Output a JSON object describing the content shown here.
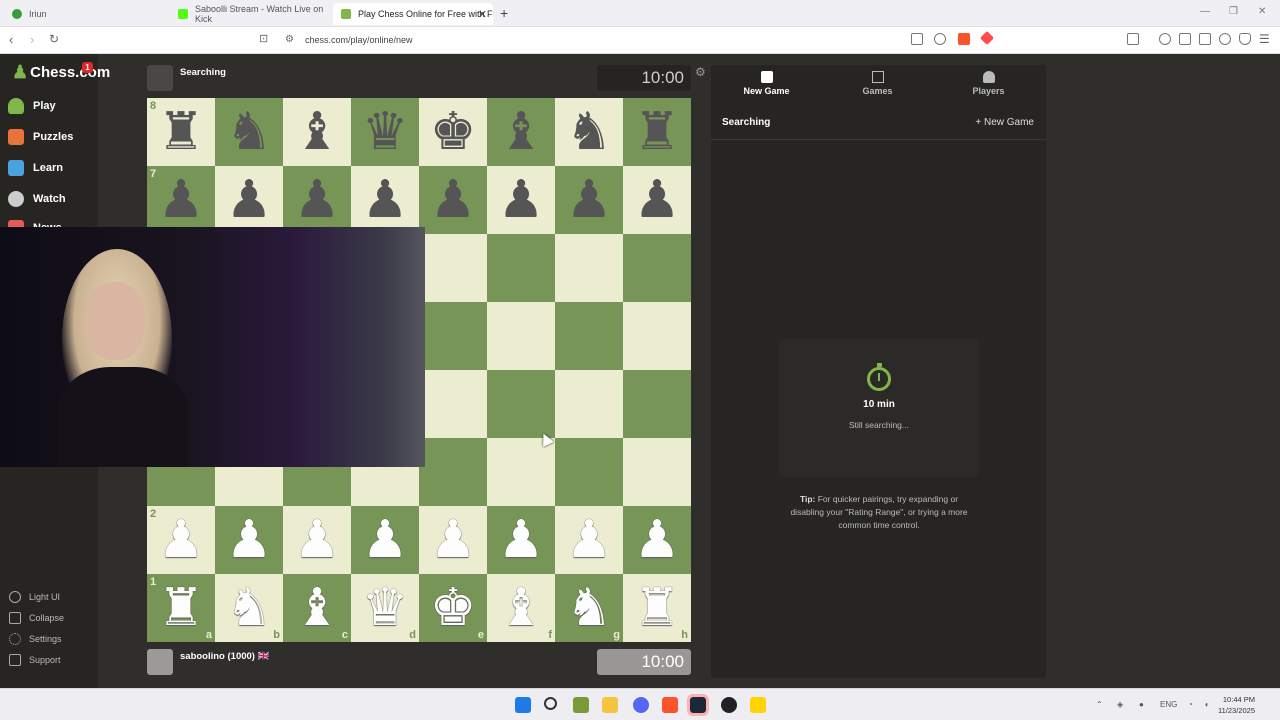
{
  "browser": {
    "tabs": [
      {
        "title": "Iriun",
        "active": false,
        "color": "#3a9b3a"
      },
      {
        "title": "Saboolli Stream - Watch Live on Kick",
        "active": false,
        "color": "#53fc18"
      },
      {
        "title": "Play Chess Online for Free with F",
        "active": true,
        "color": "#81b64c"
      }
    ],
    "url": "chess.com/play/online/new"
  },
  "sidebar": {
    "logo_text": "Chess.com",
    "logo_badge": "1",
    "items": [
      {
        "label": "Play",
        "icon": "play-pawn-icon",
        "color": "#81b64c"
      },
      {
        "label": "Puzzles",
        "icon": "puzzle-icon",
        "color": "#e8743b"
      },
      {
        "label": "Learn",
        "icon": "learn-icon",
        "color": "#4aa3df"
      },
      {
        "label": "Watch",
        "icon": "binoculars-icon",
        "color": "#cccccc"
      },
      {
        "label": "News",
        "icon": "news-icon",
        "color": "#e25a5a"
      }
    ],
    "bottom_items": [
      {
        "label": "Light UI",
        "icon": "contrast-icon"
      },
      {
        "label": "Collapse",
        "icon": "collapse-icon"
      },
      {
        "label": "Settings",
        "icon": "gear-icon"
      },
      {
        "label": "Support",
        "icon": "help-icon"
      }
    ]
  },
  "game": {
    "opponent_label": "Searching",
    "opponent_clock": "10:00",
    "player_label": "saboolino (1000) 🇬🇧",
    "player_clock": "10:00",
    "board": [
      [
        "♜",
        "♞",
        "♝",
        "♛",
        "♚",
        "♝",
        "♞",
        "♜"
      ],
      [
        "♟",
        "♟",
        "♟",
        "♟",
        "♟",
        "♟",
        "♟",
        "♟"
      ],
      [
        "",
        "",
        "",
        "",
        "",
        "",
        "",
        ""
      ],
      [
        "",
        "",
        "",
        "",
        "",
        "",
        "",
        ""
      ],
      [
        "",
        "",
        "",
        "",
        "",
        "",
        "",
        ""
      ],
      [
        "",
        "",
        "",
        "",
        "",
        "",
        "",
        ""
      ],
      [
        "♟",
        "♟",
        "♟",
        "♟",
        "♟",
        "♟",
        "♟",
        "♟"
      ],
      [
        "♜",
        "♞",
        "♝",
        "♛",
        "♚",
        "♝",
        "♞",
        "♜"
      ]
    ],
    "piece_colors": [
      "b",
      "b",
      "",
      "",
      "",
      "",
      "w",
      "w"
    ],
    "rank_labels": [
      "8",
      "7",
      "",
      "",
      "",
      "",
      "2",
      "1"
    ],
    "file_labels": [
      "a",
      "b",
      "c",
      "d",
      "e",
      "f",
      "g",
      "h"
    ]
  },
  "right_panel": {
    "tabs": [
      {
        "label": "New Game",
        "icon": "new-game-icon",
        "active": true
      },
      {
        "label": "Games",
        "icon": "games-grid-icon",
        "active": false
      },
      {
        "label": "Players",
        "icon": "players-icon",
        "active": false
      }
    ],
    "status": "Searching",
    "new_game_link": "+ New Game",
    "card": {
      "time": "10 min",
      "status": "Still searching..."
    },
    "tip_label": "Tip:",
    "tip_text": " For quicker pairings, try expanding or disabling your \"Rating Range\", or trying a more common time control."
  },
  "taskbar": {
    "lang": "ENG",
    "time": "10:44 PM",
    "date": "11/23/2025"
  }
}
